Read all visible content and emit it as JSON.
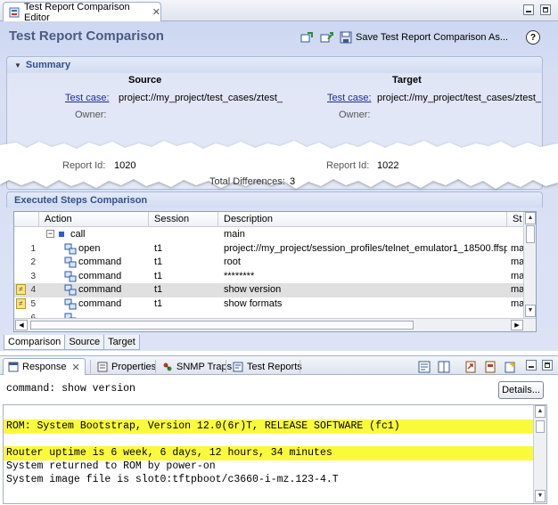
{
  "editor_tab": {
    "title": "Test Report Comparison Editor",
    "close": "✕"
  },
  "form": {
    "title": "Test Report Comparison",
    "save_as_label": "Save Test Report Comparison As...",
    "help_label": "?"
  },
  "summary": {
    "title": "Summary",
    "source_heading": "Source",
    "target_heading": "Target",
    "source": {
      "test_case_label": "Test case:",
      "test_case_value": "project://my_project/test_cases/ztest_",
      "owner_label": "Owner:",
      "report_id_label": "Report Id:",
      "report_id_value": "1020"
    },
    "target": {
      "test_case_label": "Test case:",
      "test_case_value": "project://my_project/test_cases/ztest_",
      "owner_label": "Owner:",
      "report_id_label": "Report Id:",
      "report_id_value": "1022"
    },
    "total_differences_label": "Total Differences:",
    "total_differences_value": "3"
  },
  "steps": {
    "title": "Executed Steps Comparison",
    "columns": [
      "Action",
      "Session",
      "Description",
      "St"
    ],
    "rows": [
      {
        "num": "",
        "marker": false,
        "icon": "expand",
        "action": "call",
        "session": "",
        "description": "main",
        "status": ""
      },
      {
        "num": "1",
        "marker": false,
        "icon": "step",
        "action": "open",
        "session": "t1",
        "description": "project://my_project/session_profiles/telnet_emulator1_18500.ffsp",
        "status": "ma"
      },
      {
        "num": "2",
        "marker": false,
        "icon": "step",
        "action": "command",
        "session": "t1",
        "description": "root",
        "status": "ma"
      },
      {
        "num": "3",
        "marker": false,
        "icon": "step",
        "action": "command",
        "session": "t1",
        "description": "********",
        "status": "ma"
      },
      {
        "num": "4",
        "marker": true,
        "icon": "step",
        "action": "command",
        "session": "t1",
        "description": "show version",
        "status": "ma"
      },
      {
        "num": "5",
        "marker": true,
        "icon": "step",
        "action": "command",
        "session": "t1",
        "description": "show formats",
        "status": "ma"
      },
      {
        "num": "6",
        "marker": false,
        "icon": "step",
        "action": "",
        "session": "",
        "description": "",
        "status": ""
      }
    ]
  },
  "editor_pages": [
    "Comparison",
    "Source",
    "Target"
  ],
  "views": {
    "tabs": [
      {
        "label": "Response",
        "active": true
      },
      {
        "label": "Properties",
        "active": false
      },
      {
        "label": "SNMP Traps",
        "active": false
      },
      {
        "label": "Test Reports",
        "active": false
      }
    ]
  },
  "response": {
    "command_text": "command: show version",
    "details_label": "Details...",
    "lines": [
      {
        "text": "",
        "highlight": false
      },
      {
        "text": "ROM: System Bootstrap, Version 12.0(6r)T, RELEASE SOFTWARE (fc1)",
        "highlight": true
      },
      {
        "text": "",
        "highlight": false
      },
      {
        "text": "Router uptime is 6 week, 6 days, 12 hours, 34 minutes",
        "highlight": true
      },
      {
        "text": "System returned to ROM by power-on",
        "highlight": false
      },
      {
        "text": "System image file is slot0:tftpboot/c3660-i-mz.123-4.T",
        "highlight": false
      }
    ]
  },
  "colors": {
    "form_bg": "#d7def4",
    "title": "#4a5c82",
    "highlight": "#fafa3c",
    "link": "#1a2e9c"
  }
}
